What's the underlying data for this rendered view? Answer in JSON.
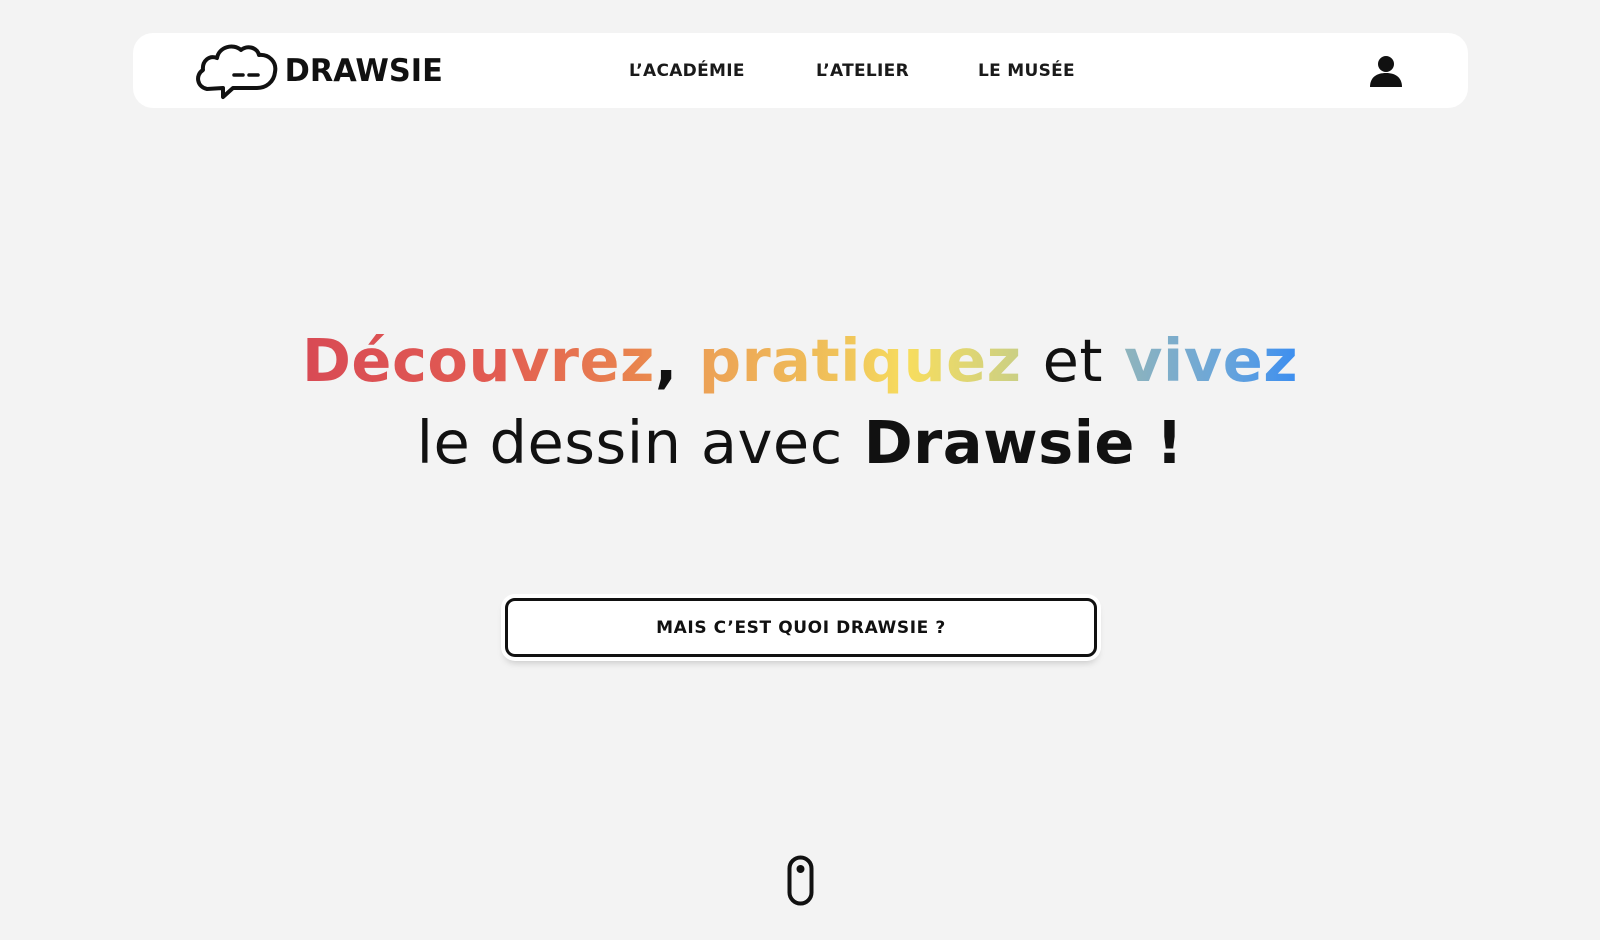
{
  "brand": {
    "name": "DRAWSIE",
    "logo_icon": "cloud-speech-bubble-icon"
  },
  "nav": {
    "items": [
      {
        "label": "L’ACADÉMIE"
      },
      {
        "label": "L’ATELIER"
      },
      {
        "label": "LE MUSÉE"
      }
    ],
    "user_icon": "user-account-icon"
  },
  "hero": {
    "word1": "Découvrez",
    "comma": ",",
    "word2": "pratiquez",
    "connector": "et",
    "word3": "vivez",
    "line2_start": "le dessin avec",
    "line2_brand": "Drawsie !"
  },
  "cta": {
    "label": "MAIS C’EST QUOI DRAWSIE ?"
  },
  "scroll": {
    "icon": "mouse-scroll-icon"
  },
  "colors": {
    "background": "#f3f3f3",
    "navbar": "#ffffff",
    "text": "#111111",
    "gradient_red": "#d84a54",
    "gradient_orange": "#ea8a4e",
    "gradient_yellow": "#f7dd5e",
    "gradient_blue": "#3c8ef0"
  }
}
